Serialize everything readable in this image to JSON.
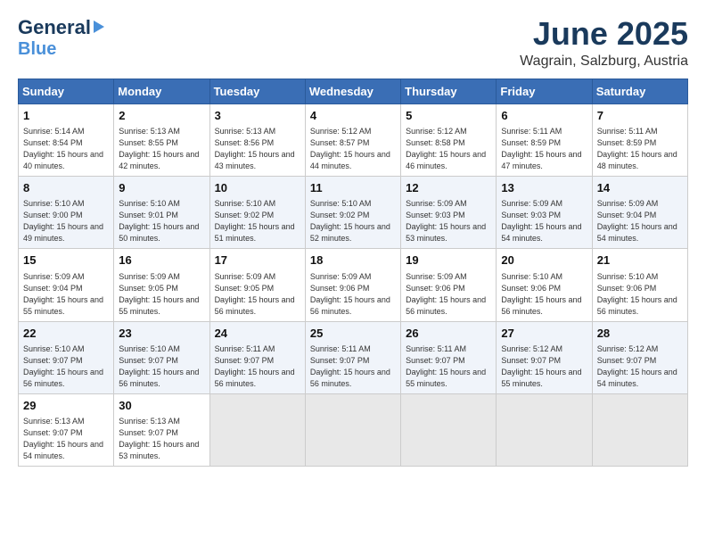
{
  "header": {
    "logo_general": "General",
    "logo_blue": "Blue",
    "title": "June 2025",
    "subtitle": "Wagrain, Salzburg, Austria"
  },
  "calendar": {
    "days_of_week": [
      "Sunday",
      "Monday",
      "Tuesday",
      "Wednesday",
      "Thursday",
      "Friday",
      "Saturday"
    ],
    "weeks": [
      [
        {
          "day": "1",
          "sunrise": "Sunrise: 5:14 AM",
          "sunset": "Sunset: 8:54 PM",
          "daylight": "Daylight: 15 hours and 40 minutes."
        },
        {
          "day": "2",
          "sunrise": "Sunrise: 5:13 AM",
          "sunset": "Sunset: 8:55 PM",
          "daylight": "Daylight: 15 hours and 42 minutes."
        },
        {
          "day": "3",
          "sunrise": "Sunrise: 5:13 AM",
          "sunset": "Sunset: 8:56 PM",
          "daylight": "Daylight: 15 hours and 43 minutes."
        },
        {
          "day": "4",
          "sunrise": "Sunrise: 5:12 AM",
          "sunset": "Sunset: 8:57 PM",
          "daylight": "Daylight: 15 hours and 44 minutes."
        },
        {
          "day": "5",
          "sunrise": "Sunrise: 5:12 AM",
          "sunset": "Sunset: 8:58 PM",
          "daylight": "Daylight: 15 hours and 46 minutes."
        },
        {
          "day": "6",
          "sunrise": "Sunrise: 5:11 AM",
          "sunset": "Sunset: 8:59 PM",
          "daylight": "Daylight: 15 hours and 47 minutes."
        },
        {
          "day": "7",
          "sunrise": "Sunrise: 5:11 AM",
          "sunset": "Sunset: 8:59 PM",
          "daylight": "Daylight: 15 hours and 48 minutes."
        }
      ],
      [
        {
          "day": "8",
          "sunrise": "Sunrise: 5:10 AM",
          "sunset": "Sunset: 9:00 PM",
          "daylight": "Daylight: 15 hours and 49 minutes."
        },
        {
          "day": "9",
          "sunrise": "Sunrise: 5:10 AM",
          "sunset": "Sunset: 9:01 PM",
          "daylight": "Daylight: 15 hours and 50 minutes."
        },
        {
          "day": "10",
          "sunrise": "Sunrise: 5:10 AM",
          "sunset": "Sunset: 9:02 PM",
          "daylight": "Daylight: 15 hours and 51 minutes."
        },
        {
          "day": "11",
          "sunrise": "Sunrise: 5:10 AM",
          "sunset": "Sunset: 9:02 PM",
          "daylight": "Daylight: 15 hours and 52 minutes."
        },
        {
          "day": "12",
          "sunrise": "Sunrise: 5:09 AM",
          "sunset": "Sunset: 9:03 PM",
          "daylight": "Daylight: 15 hours and 53 minutes."
        },
        {
          "day": "13",
          "sunrise": "Sunrise: 5:09 AM",
          "sunset": "Sunset: 9:03 PM",
          "daylight": "Daylight: 15 hours and 54 minutes."
        },
        {
          "day": "14",
          "sunrise": "Sunrise: 5:09 AM",
          "sunset": "Sunset: 9:04 PM",
          "daylight": "Daylight: 15 hours and 54 minutes."
        }
      ],
      [
        {
          "day": "15",
          "sunrise": "Sunrise: 5:09 AM",
          "sunset": "Sunset: 9:04 PM",
          "daylight": "Daylight: 15 hours and 55 minutes."
        },
        {
          "day": "16",
          "sunrise": "Sunrise: 5:09 AM",
          "sunset": "Sunset: 9:05 PM",
          "daylight": "Daylight: 15 hours and 55 minutes."
        },
        {
          "day": "17",
          "sunrise": "Sunrise: 5:09 AM",
          "sunset": "Sunset: 9:05 PM",
          "daylight": "Daylight: 15 hours and 56 minutes."
        },
        {
          "day": "18",
          "sunrise": "Sunrise: 5:09 AM",
          "sunset": "Sunset: 9:06 PM",
          "daylight": "Daylight: 15 hours and 56 minutes."
        },
        {
          "day": "19",
          "sunrise": "Sunrise: 5:09 AM",
          "sunset": "Sunset: 9:06 PM",
          "daylight": "Daylight: 15 hours and 56 minutes."
        },
        {
          "day": "20",
          "sunrise": "Sunrise: 5:10 AM",
          "sunset": "Sunset: 9:06 PM",
          "daylight": "Daylight: 15 hours and 56 minutes."
        },
        {
          "day": "21",
          "sunrise": "Sunrise: 5:10 AM",
          "sunset": "Sunset: 9:06 PM",
          "daylight": "Daylight: 15 hours and 56 minutes."
        }
      ],
      [
        {
          "day": "22",
          "sunrise": "Sunrise: 5:10 AM",
          "sunset": "Sunset: 9:07 PM",
          "daylight": "Daylight: 15 hours and 56 minutes."
        },
        {
          "day": "23",
          "sunrise": "Sunrise: 5:10 AM",
          "sunset": "Sunset: 9:07 PM",
          "daylight": "Daylight: 15 hours and 56 minutes."
        },
        {
          "day": "24",
          "sunrise": "Sunrise: 5:11 AM",
          "sunset": "Sunset: 9:07 PM",
          "daylight": "Daylight: 15 hours and 56 minutes."
        },
        {
          "day": "25",
          "sunrise": "Sunrise: 5:11 AM",
          "sunset": "Sunset: 9:07 PM",
          "daylight": "Daylight: 15 hours and 56 minutes."
        },
        {
          "day": "26",
          "sunrise": "Sunrise: 5:11 AM",
          "sunset": "Sunset: 9:07 PM",
          "daylight": "Daylight: 15 hours and 55 minutes."
        },
        {
          "day": "27",
          "sunrise": "Sunrise: 5:12 AM",
          "sunset": "Sunset: 9:07 PM",
          "daylight": "Daylight: 15 hours and 55 minutes."
        },
        {
          "day": "28",
          "sunrise": "Sunrise: 5:12 AM",
          "sunset": "Sunset: 9:07 PM",
          "daylight": "Daylight: 15 hours and 54 minutes."
        }
      ],
      [
        {
          "day": "29",
          "sunrise": "Sunrise: 5:13 AM",
          "sunset": "Sunset: 9:07 PM",
          "daylight": "Daylight: 15 hours and 54 minutes."
        },
        {
          "day": "30",
          "sunrise": "Sunrise: 5:13 AM",
          "sunset": "Sunset: 9:07 PM",
          "daylight": "Daylight: 15 hours and 53 minutes."
        },
        null,
        null,
        null,
        null,
        null
      ]
    ]
  }
}
